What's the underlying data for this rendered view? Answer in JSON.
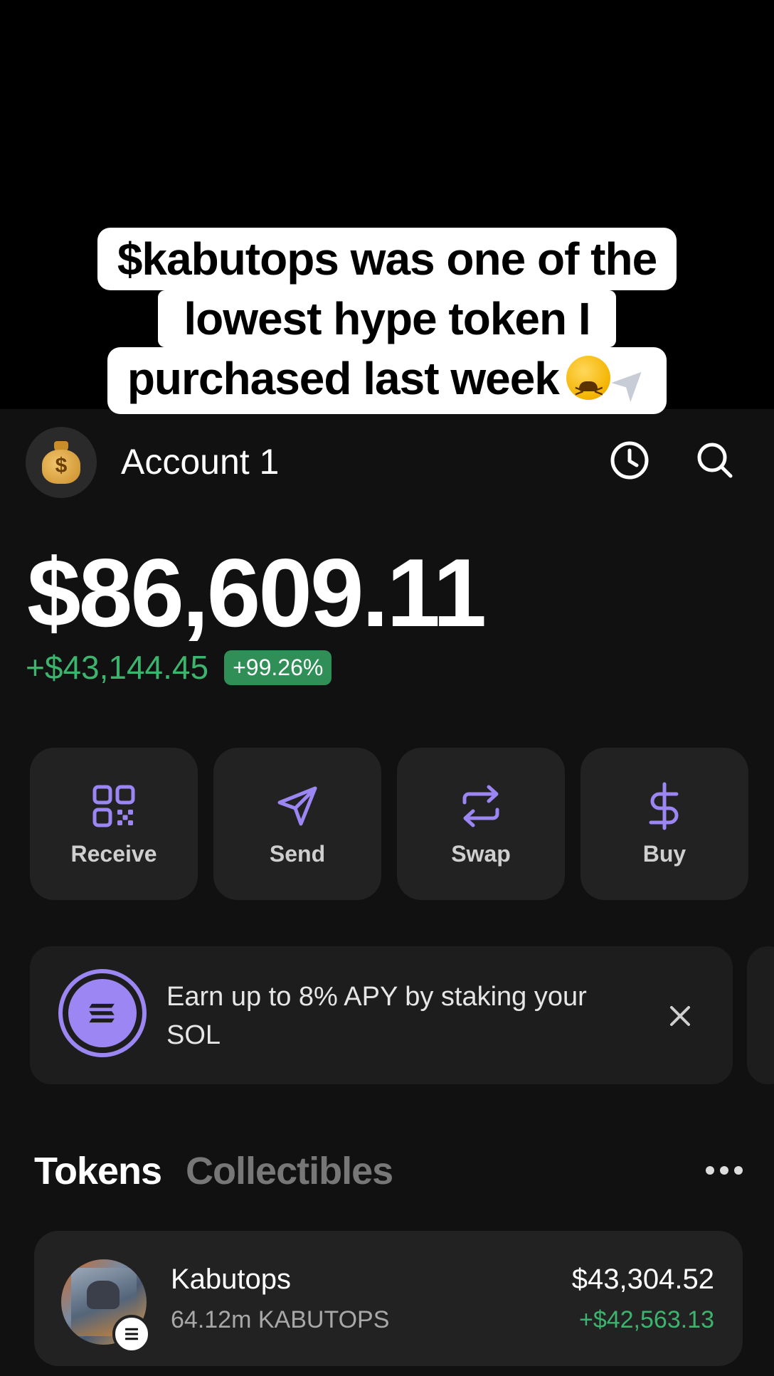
{
  "caption": {
    "line1": "$kabutops was one of the",
    "line2": "lowest hype token I",
    "line3": "purchased last week",
    "emojis": [
      "tired-face-emoji",
      "rocket-emoji"
    ]
  },
  "header": {
    "account_name": "Account 1",
    "avatar_icon": "money-bag-icon",
    "icons": [
      "history-icon",
      "search-icon"
    ]
  },
  "balance": {
    "total": "$86,609.11",
    "change_abs": "+$43,144.45",
    "change_pct": "+99.26%"
  },
  "actions": [
    {
      "label": "Receive",
      "icon": "qr-code-icon"
    },
    {
      "label": "Send",
      "icon": "send-icon"
    },
    {
      "label": "Swap",
      "icon": "swap-icon"
    },
    {
      "label": "Buy",
      "icon": "dollar-icon"
    }
  ],
  "promo": {
    "text": "Earn up to 8% APY by staking your SOL",
    "icon": "solana-icon",
    "close_icon": "close-icon"
  },
  "tabs": {
    "items": [
      {
        "label": "Tokens",
        "active": true
      },
      {
        "label": "Collectibles",
        "active": false
      }
    ],
    "more_icon": "more-icon"
  },
  "tokens": [
    {
      "name": "Kabutops",
      "amount": "64.12m KABUTOPS",
      "value": "$43,304.52",
      "change": "+$42,563.13"
    }
  ],
  "colors": {
    "accent_purple": "#9b86f3",
    "positive_green": "#3db46d",
    "badge_green": "#2f8f57",
    "background": "#111111",
    "card": "#222222"
  }
}
